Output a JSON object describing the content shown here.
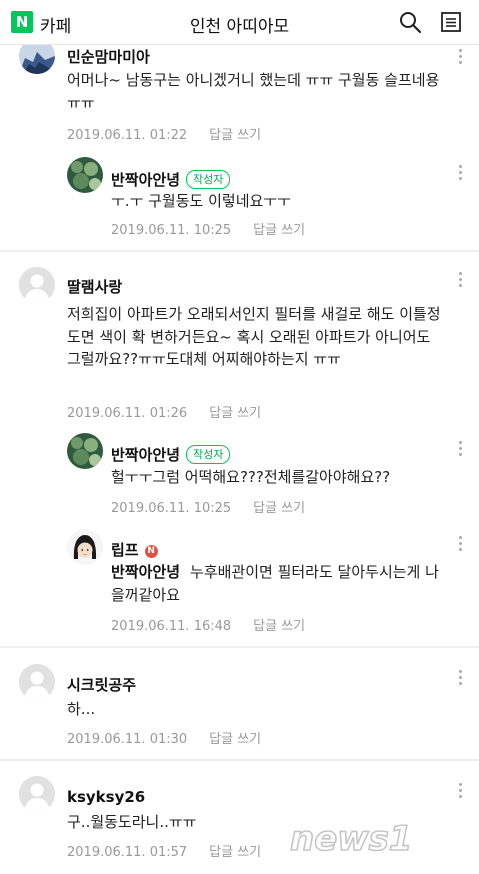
{
  "header": {
    "logo": "N",
    "brand": "카페",
    "title": "인천 아띠아모",
    "search_icon": "search-icon",
    "menu_icon": "menu-icon"
  },
  "comments": [
    {
      "nickname": "민순맘마미아",
      "text": "어머나~ 남동구는 아니겠거니 했는데 ㅠㅠ 구월동 슬프네용 ㅠㅠ",
      "date": "2019.06.11. 01:22",
      "reply_label": "답글 쓰기"
    },
    {
      "nickname": "반짝아안녕",
      "badge": "작성자",
      "text": "ㅜ.ㅜ 구월동도 이렇네요ㅜㅜ",
      "date": "2019.06.11. 10:25",
      "reply_label": "답글 쓰기"
    },
    {
      "nickname": "딸램사랑",
      "text": "저희집이 아파트가 오래되서인지 필터를 새걸로 해도 이틀정도면 색이 확 변하거든요~ 혹시 오래된 아파트가 아니어도 그럴까요??ㅠㅠ도대체 어찌해야하는지 ㅠㅠ",
      "date": "2019.06.11. 01:26",
      "reply_label": "답글 쓰기"
    },
    {
      "nickname": "반짝아안녕",
      "badge": "작성자",
      "text": "헐ㅜㅜ그럼 어떡해요???전체를갈아야해요??",
      "date": "2019.06.11. 10:25",
      "reply_label": "답글 쓰기"
    },
    {
      "nickname": "립프",
      "n_badge": "N",
      "mention": "반짝아안녕",
      "text": "누후배관이면 필터라도 달아두시는게 나을꺼같아요",
      "date": "2019.06.11. 16:48",
      "reply_label": "답글 쓰기"
    },
    {
      "nickname": "시크릿공주",
      "text": "하...",
      "date": "2019.06.11. 01:30",
      "reply_label": "답글 쓰기"
    },
    {
      "nickname": "ksyksy26",
      "text": "구..월동도라니..ㅠㅠ",
      "date": "2019.06.11. 01:57",
      "reply_label": "답글 쓰기"
    }
  ],
  "watermark": {
    "text": "news1"
  },
  "colors": {
    "brand_green": "#03c75a",
    "meta_gray": "#999999",
    "divider": "#efefef"
  }
}
